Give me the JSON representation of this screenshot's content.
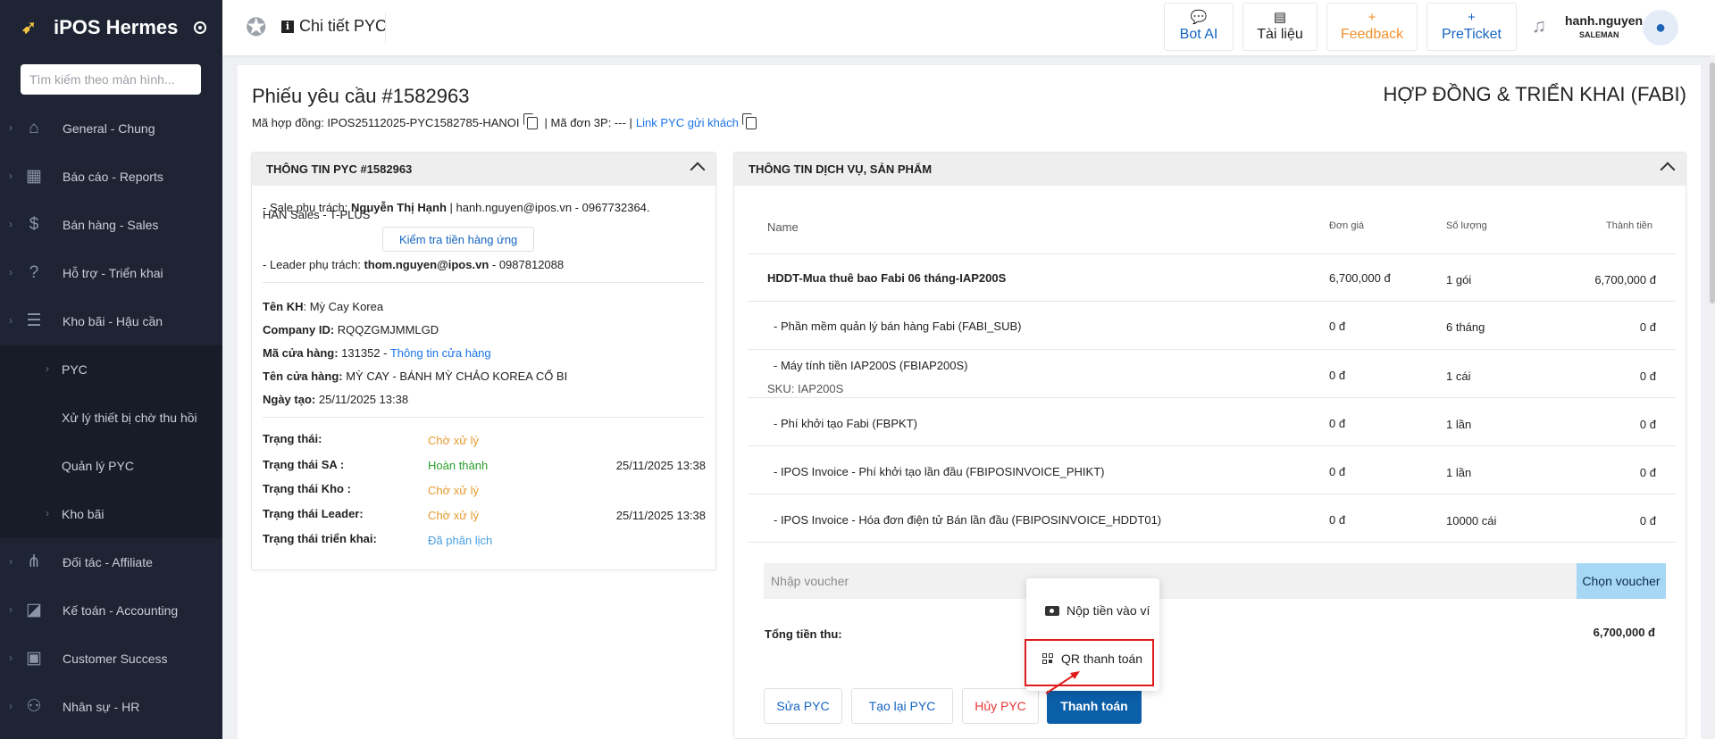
{
  "sidebar": {
    "brand": "iPOS Hermes",
    "search_placeholder": "Tìm kiếm theo màn hình...",
    "items": [
      {
        "label": "General - Chung",
        "icon": "home-icon"
      },
      {
        "label": "Báo cáo - Reports",
        "icon": "chart-icon"
      },
      {
        "label": "Bán hàng - Sales",
        "icon": "dollar-icon"
      },
      {
        "label": "Hỗ trợ - Triển khai",
        "icon": "help-icon"
      },
      {
        "label": "Kho bãi - Hậu cần",
        "icon": "list-icon"
      }
    ],
    "sub_items": [
      {
        "label": "PYC"
      },
      {
        "label": "Xử lý thiết bị chờ thu hồi"
      },
      {
        "label": "Quản lý PYC"
      },
      {
        "label": "Kho bãi"
      }
    ],
    "items2": [
      {
        "label": "Đối tác - Affiliate",
        "icon": "network-icon"
      },
      {
        "label": "Kế toán - Accounting",
        "icon": "accounting-icon"
      },
      {
        "label": "Customer Success",
        "icon": "contact-icon"
      },
      {
        "label": "Nhân sự - HR",
        "icon": "people-icon"
      }
    ]
  },
  "header": {
    "title": "Chi tiết PYC",
    "buttons": [
      {
        "label": "Bot AI"
      },
      {
        "label": "Tài liệu"
      },
      {
        "label": "Feedback"
      },
      {
        "label": "PreTicket"
      }
    ],
    "user_name": "hanh.nguyen",
    "user_role": "SALEMAN"
  },
  "page": {
    "title": "Phiếu yêu cầu #1582963",
    "right_title": "HỢP ĐỒNG & TRIỂN KHAI (FABI)",
    "contract_label": "Mã hợp đồng: IPOS25112025-PYC1582785-HANOI",
    "order_3p": "| Mã đơn 3P: --- |",
    "link_label": "Link PYC gửi khách"
  },
  "left_panel": {
    "title": "THÔNG TIN PYC #1582963",
    "sale_prefix": "- Sale phụ trách: ",
    "sale_name": "Nguyễn Thị Hạnh",
    "sale_contact": " | hanh.nguyen@ipos.vn - 0967732364.",
    "team": "HAN Sales - T-PLUS",
    "check_button": "Kiểm tra tiền hàng ứng",
    "leader_prefix": "- Leader phụ trách: ",
    "leader_email": "thom.nguyen@ipos.vn",
    "leader_phone": " - 0987812088",
    "customer_label": "Tên KH",
    "customer_value": ": Mỳ Cay Korea",
    "company_label": "Company ID:",
    "company_value": " RQQZGMJMMLGD",
    "store_code_label": "Mã cửa hàng:",
    "store_code_value": " 131352 - ",
    "store_info_link": "Thông tin cửa hàng",
    "store_name_label": "Tên cửa hàng:",
    "store_name_value": " MỲ CAY - BÁNH MỲ CHẢO KOREA CỔ BI",
    "created_label": "Ngày tạo:",
    "created_value": " 25/11/2025 13:38",
    "statuses": [
      {
        "label": "Trạng thái:",
        "value": "Chờ xử lý",
        "date": ""
      },
      {
        "label": "Trạng thái SA :",
        "value": "Hoàn thành",
        "date": "25/11/2025 13:38"
      },
      {
        "label": "Trạng thái Kho :",
        "value": "Chờ xử lý",
        "date": ""
      },
      {
        "label": "Trạng thái Leader:",
        "value": "Chờ xử lý",
        "date": "25/11/2025 13:38"
      },
      {
        "label": "Trạng thái triển khai:",
        "value": "Đã phân lịch",
        "date": ""
      }
    ]
  },
  "right_panel": {
    "title": "THÔNG TIN DỊCH VỤ, SẢN PHẨM",
    "columns": {
      "name": "Name",
      "price": "Đơn giá",
      "qty": "Số lượng",
      "total": "Thành tiền"
    },
    "rows": [
      {
        "name": "HDDT-Mua thuê bao Fabi 06 tháng-IAP200S",
        "sku": "",
        "price": "6,700,000 đ",
        "qty": "1 gói",
        "total": "6,700,000 đ"
      },
      {
        "name": "- Phần mềm quản lý bán hàng Fabi (FABI_SUB)",
        "sku": "",
        "price": "0 đ",
        "qty": "6 tháng",
        "total": "0 đ"
      },
      {
        "name": "- Máy tính tiền IAP200S (FBIAP200S)",
        "sku": "SKU: IAP200S",
        "price": "0 đ",
        "qty": "1 cái",
        "total": "0 đ"
      },
      {
        "name": "- Phí khởi tạo Fabi (FBPKT)",
        "sku": "",
        "price": "0 đ",
        "qty": "1 lần",
        "total": "0 đ"
      },
      {
        "name": "- IPOS Invoice - Phí khởi tạo lần đầu (FBIPOSINVOICE_PHIKT)",
        "sku": "",
        "price": "0 đ",
        "qty": "1 lần",
        "total": "0 đ"
      },
      {
        "name": "- IPOS Invoice - Hóa đơn điện tử Bán lần đầu (FBIPOSINVOICE_HDDT01)",
        "sku": "",
        "price": "0 đ",
        "qty": "10000 cái",
        "total": "0 đ"
      }
    ],
    "voucher_placeholder": "Nhập voucher",
    "voucher_button": "Chọn voucher",
    "total_label": "Tổng tiền thu:",
    "total_value": "6,700,000 đ",
    "actions": [
      {
        "label": "Sửa PYC"
      },
      {
        "label": "Tạo lại PYC"
      },
      {
        "label": "Hủy PYC"
      },
      {
        "label": "Thanh toán"
      }
    ]
  },
  "popup": {
    "items": [
      {
        "label": "Nộp tiền vào ví"
      },
      {
        "label": "QR thanh toán"
      }
    ]
  },
  "colors": {
    "sidebar": "#1e2433",
    "accent": "#1565c0",
    "orange": "#e59a2f",
    "green": "#2ca02c",
    "danger": "#e53935",
    "highlight": "#e01b1b"
  }
}
